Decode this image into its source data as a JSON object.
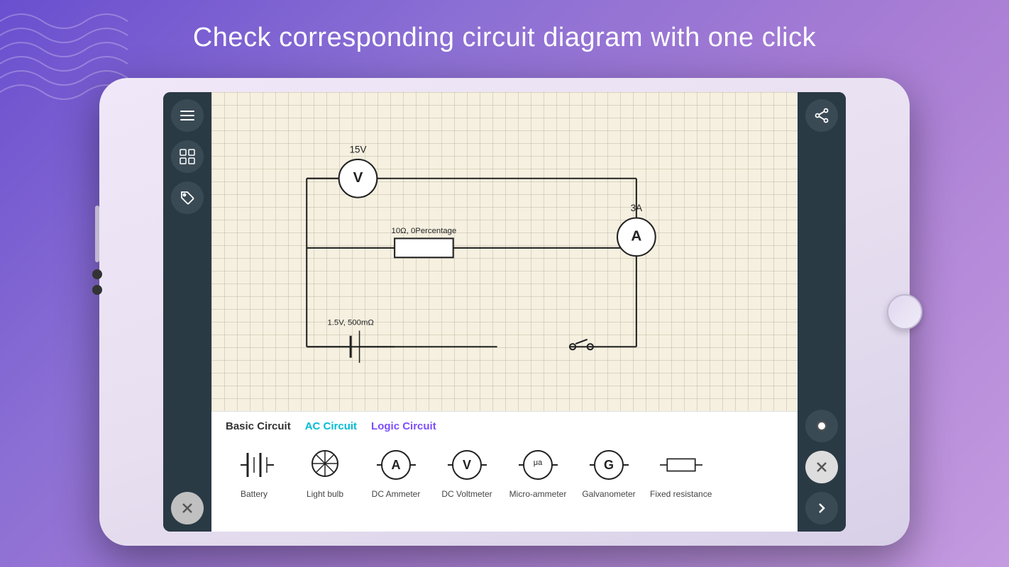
{
  "page": {
    "title": "Check corresponding circuit diagram with one click",
    "background": "#8b6fd4"
  },
  "toolbar_left": {
    "menu_label": "menu",
    "grid_label": "grid",
    "tag_label": "tag"
  },
  "toolbar_right": {
    "share_label": "share",
    "pencil_label": "pencil",
    "close_label": "close",
    "next_label": "next"
  },
  "circuit": {
    "voltmeter_value": "15V",
    "ammeter_value": "3A",
    "resistor_label": "10Ω, 0Percentage",
    "battery_label": "1.5V, 500mΩ"
  },
  "tabs": [
    {
      "label": "Basic Circuit",
      "active": true,
      "style": "bold"
    },
    {
      "label": "AC Circuit",
      "active": false,
      "style": "cyan"
    },
    {
      "label": "Logic Circuit",
      "active": false,
      "style": "purple"
    }
  ],
  "components": [
    {
      "name": "battery",
      "label": "Battery",
      "icon": "battery"
    },
    {
      "name": "light-bulb",
      "label": "Light bulb",
      "icon": "lightbulb"
    },
    {
      "name": "dc-ammeter",
      "label": "DC Ammeter",
      "icon": "ammeter"
    },
    {
      "name": "dc-voltmeter",
      "label": "DC Voltmeter",
      "icon": "voltmeter"
    },
    {
      "name": "micro-ammeter",
      "label": "Micro-ammeter",
      "icon": "microammeter"
    },
    {
      "name": "galvanometer",
      "label": "Galvanometer",
      "icon": "galvanometer"
    },
    {
      "name": "fixed-resistance",
      "label": "Fixed resistance",
      "icon": "resistor"
    }
  ]
}
